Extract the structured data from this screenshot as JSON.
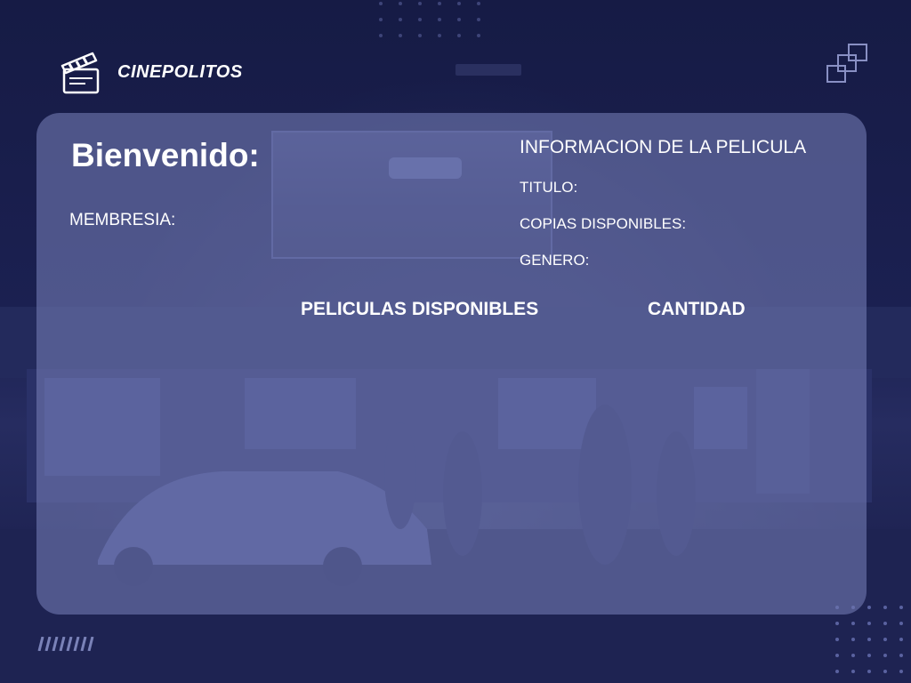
{
  "brand": {
    "name": "CINEPOLITOS",
    "icon": "clapperboard-icon"
  },
  "welcome": {
    "label": "Bienvenido:"
  },
  "membership": {
    "label": "MEMBRESIA:"
  },
  "movie_info": {
    "title": "INFORMACION DE LA PELICULA",
    "titulo_label": "TITULO:",
    "copias_label": "COPIAS DISPONIBLES:",
    "genero_label": "GENERO:"
  },
  "movies_table": {
    "col_movies": "PELICULAS DISPONIBLES",
    "col_quantity": "CANTIDAD"
  },
  "colors": {
    "background": "#1c2150",
    "panel": "#7078b0",
    "text": "#ffffff"
  }
}
